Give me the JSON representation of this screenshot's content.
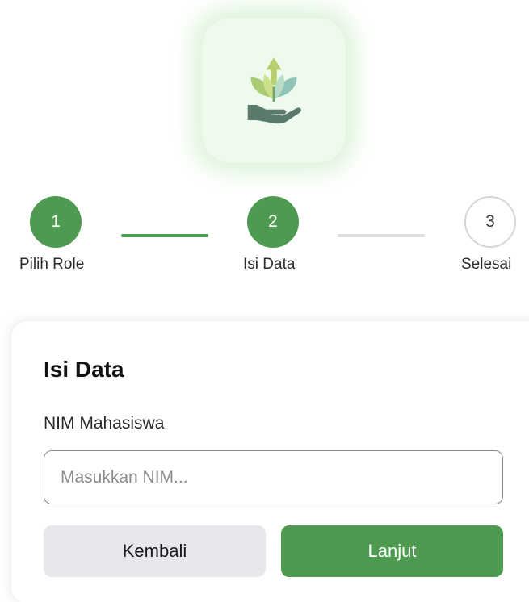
{
  "logo": {
    "icon": "plant-in-hand-icon",
    "accent": "#4e9a51"
  },
  "stepper": {
    "steps": [
      {
        "number": "1",
        "label": "Pilih Role",
        "state": "done"
      },
      {
        "number": "2",
        "label": "Isi Data",
        "state": "active"
      },
      {
        "number": "3",
        "label": "Selesai",
        "state": "todo"
      }
    ]
  },
  "form": {
    "title": "Isi Data",
    "nim_label": "NIM Mahasiswa",
    "nim_placeholder": "Masukkan NIM...",
    "nim_value": "",
    "back_label": "Kembali",
    "next_label": "Lanjut"
  },
  "colors": {
    "primary": "#4e9a51",
    "secondary_button": "#e8e8ec",
    "inactive_line": "#dedee0"
  }
}
